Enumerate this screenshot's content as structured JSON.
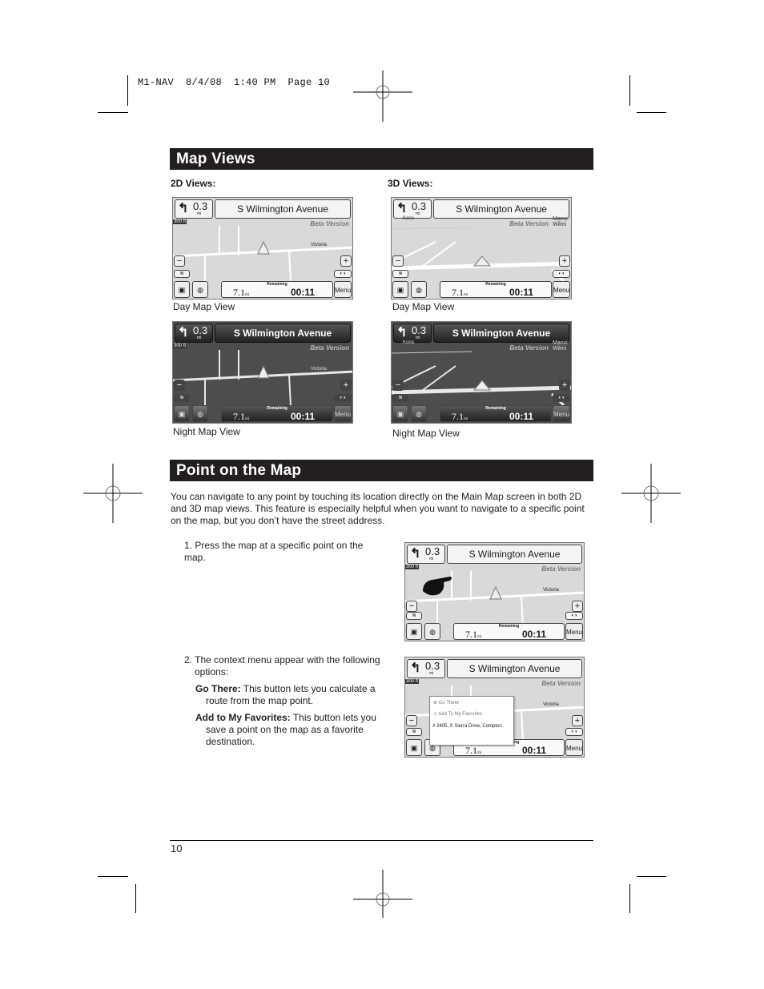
{
  "slug": "M1-NAV  8/4/08  1:40 PM  Page 10",
  "sections": {
    "map_views": {
      "title": "Map Views",
      "subhead_2d": "2D Views:",
      "subhead_3d": "3D Views:"
    },
    "point_on_map": {
      "title": "Point on the Map",
      "intro": "You can navigate to any point by touching its location directly on the Main Map screen in both 2D and 3D map views. This feature is especially helpful when you want to navigate to a specific point on the map, but you don’t have the street address.",
      "steps": [
        {
          "number": "1.",
          "text": "Press the map at a specific point on the map."
        },
        {
          "number": "2.",
          "text": "The context menu appear with the following options:"
        }
      ],
      "options": [
        {
          "term": "Go There:",
          "desc": "This button lets you calculate a route from the map point."
        },
        {
          "term": "Add to My Favorites:",
          "desc": "This button lets you save a point on the map as a favorite destination."
        }
      ]
    }
  },
  "captions": {
    "day_2d": "Day Map View",
    "day_3d": "Day Map View",
    "night_2d": "Night Map View",
    "night_3d": "Night Map View"
  },
  "nav_screen": {
    "turn_icon": "turn-left-arrow-icon",
    "distance": "0.3",
    "distance_unit": "mi",
    "street": "S Wilmington Avenue",
    "watermark": "Beta Version",
    "scale": "300 ft",
    "remaining_label": "Remaining",
    "remaining_distance": "7.1",
    "remaining_distance_unit": "mi",
    "remaining_time": "00:11",
    "menu_label": "Menu",
    "north_label": "N",
    "zoom_in": "+",
    "zoom_out": "−",
    "street_victoria": "Victoria",
    "street_3d_left": "Kona",
    "street_3d_right": "Manvi Wilmi"
  },
  "context_menu": {
    "go_there": "Go There",
    "add_favorites": "Add To My Favorites",
    "address": "# 2405, S Sierra Drive, Compton"
  },
  "footer": {
    "page_number": "10"
  }
}
